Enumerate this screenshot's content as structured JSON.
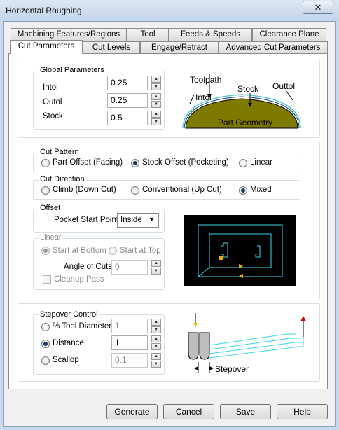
{
  "window": {
    "title": "Horizontal Roughing",
    "close": "✕"
  },
  "tabs_back": [
    "Machining Features/Regions",
    "Tool",
    "Feeds & Speeds",
    "Clearance Plane"
  ],
  "tabs_front": [
    "Cut Parameters",
    "Cut Levels",
    "Engage/Retract",
    "Advanced Cut Parameters"
  ],
  "global_params": {
    "title": "Global Parameters",
    "intol_label": "Intol",
    "intol_value": "0.25",
    "outol_label": "Outol",
    "outol_value": "0.25",
    "stock_label": "Stock",
    "stock_value": "0.5"
  },
  "diagram1": {
    "toolpath": "Toolpath",
    "stock": "Stock",
    "outtol": "Outtol",
    "intol": "Intol",
    "part": "Part Geometry"
  },
  "cut_pattern": {
    "title": "Cut Pattern",
    "opt1": "Part Offset (Facing)",
    "opt2": "Stock Offset (Pocketing)",
    "opt3": "Linear",
    "selected": "Stock Offset (Pocketing)"
  },
  "cut_direction": {
    "title": "Cut Direction",
    "opt1": "Climb (Down Cut)",
    "opt2": "Conventional (Up Cut)",
    "opt3": "Mixed",
    "selected": "Mixed"
  },
  "offset": {
    "title": "Offset",
    "label": "Pocket Start Point",
    "value": "Inside"
  },
  "linear": {
    "title": "Linear",
    "start_bottom": "Start at Bottom",
    "start_top": "Start at Top",
    "angle_label": "Angle of Cuts",
    "angle_value": "0",
    "cleanup": "Cleanup Pass"
  },
  "stepover": {
    "title": "Stepover Control",
    "opt1": "% Tool Diameter",
    "opt1_value": "1",
    "opt2": "Distance",
    "opt2_value": "1",
    "opt3": "Scallop",
    "opt3_value": "0.1",
    "selected": "Distance",
    "diagram_label": "Stepover"
  },
  "buttons": {
    "generate": "Generate",
    "cancel": "Cancel",
    "save": "Save",
    "help": "Help"
  }
}
